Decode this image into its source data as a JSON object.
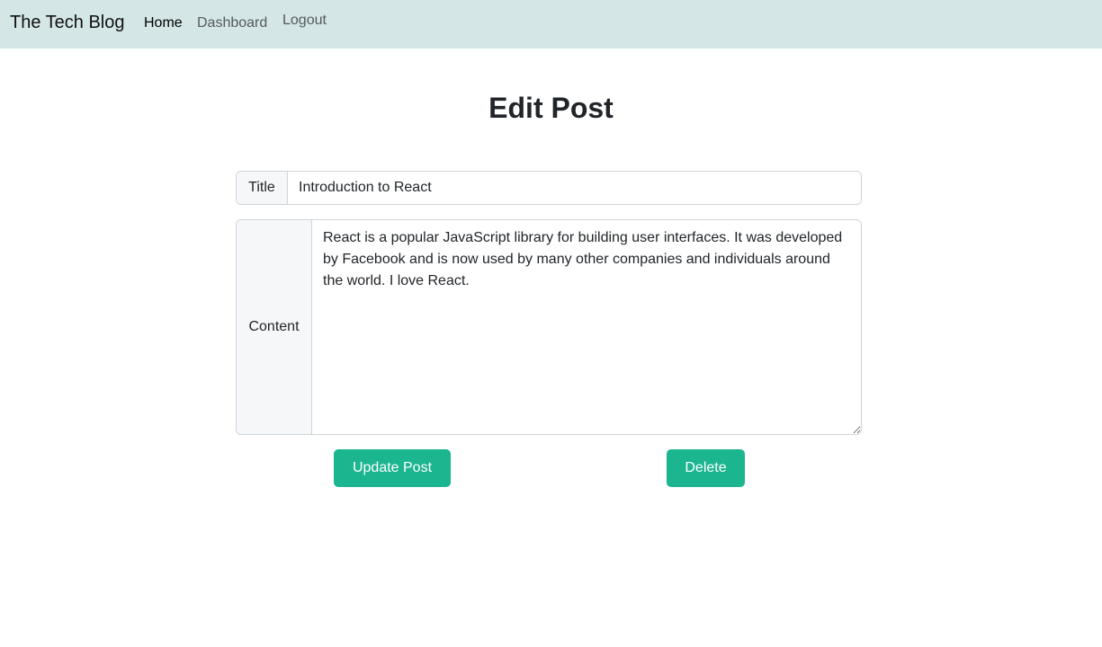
{
  "navbar": {
    "brand": "The Tech Blog",
    "links": {
      "home": "Home",
      "dashboard": "Dashboard",
      "logout": "Logout"
    },
    "background_color": "#d4e6e6"
  },
  "page": {
    "title": "Edit Post"
  },
  "form": {
    "title_label": "Title",
    "title_value": "Introduction to React",
    "content_label": "Content",
    "content_value": "React is a popular JavaScript library for building user interfaces. It was developed by Facebook and is now used by many other companies and individuals around the world. I love React.",
    "update_button": "Update Post",
    "delete_button": "Delete",
    "button_color": "#1bb590"
  }
}
